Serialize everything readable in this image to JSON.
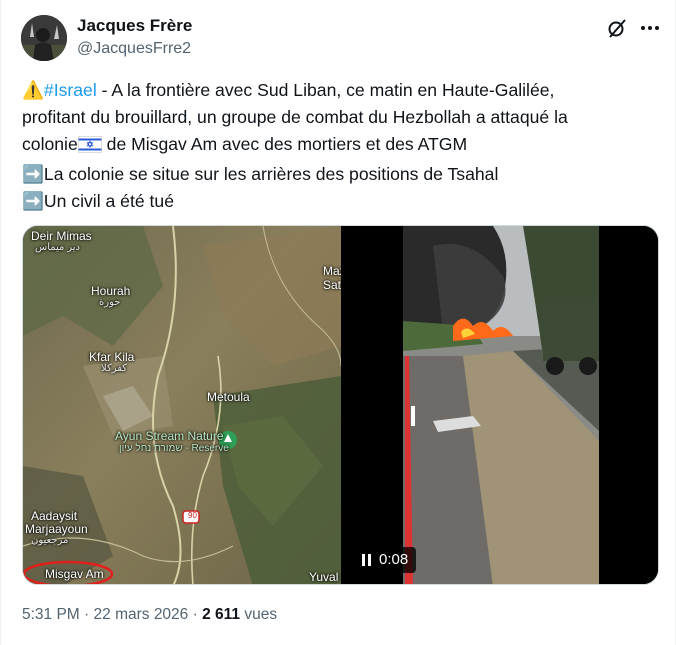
{
  "author": {
    "name": "Jacques Frère",
    "handle": "@JacquesFrre2"
  },
  "header_icons": {
    "grok": "grok-icon",
    "more": "more-icon"
  },
  "tweet": {
    "line1_emoji": "⚠️",
    "line1_hashtag": "#Israel",
    "line1_text": " - A la frontière avec Sud Liban, ce matin en Haute-Galilée,",
    "line2_text": "profitant du brouillard, un groupe de combat du Hezbollah a attaqué la",
    "line3_a": "colonie",
    "line3_flag": "israel-flag-emoji",
    "line3_b": " de Misgav Am avec des mortiers et des ATGM",
    "line4_arrow": "➡️",
    "line4_text": "La colonie se situe sur les arrières des positions de Tsahal",
    "line5_arrow": "➡️",
    "line5_text": "Un civil a été tué"
  },
  "map": {
    "labels": {
      "deir_mimas": "Deir Mimas",
      "deir_mimas_ar": "دير ميماس",
      "hourah": "Hourah",
      "hourah_ar": "حورة",
      "maz": "Maz",
      "sat": "Sat",
      "kfar_kila": "Kfar Kila",
      "kfar_kila_ar": "كفركلا",
      "metoula": "Metoula",
      "ayun_1": "Ayun Stream Nature",
      "ayun_2": "שמורת נחל עיון - Reserve",
      "aadaysit": "Aadaysit",
      "marjaayoun": "Marjaayoun",
      "marjaayoun_ar": "مرجعيون",
      "misgav_am": "Misgav Am",
      "yuval": "Yuval",
      "route": "90"
    },
    "accent": "#e0201c"
  },
  "video": {
    "state_icon": "pause-icon",
    "time": "0:08"
  },
  "meta": {
    "time": "5:31 PM",
    "sep1": " · ",
    "date": "22 mars 2026",
    "sep2": " · ",
    "views_count": "2 611",
    "views_label": " vues"
  },
  "colors": {
    "text": "#0f1419",
    "secondary": "#536471",
    "link": "#1d9bf0"
  }
}
